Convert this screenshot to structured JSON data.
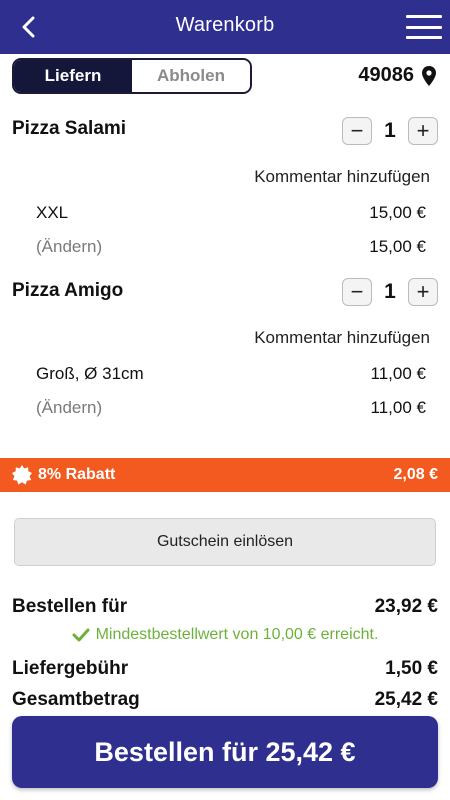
{
  "header": {
    "title": "Warenkorb",
    "back_icon": "chevron-left-icon",
    "menu_icon": "hamburger-menu-icon",
    "background": "#2e2f8f"
  },
  "delivery_toggle": {
    "options": [
      "Liefern",
      "Abholen"
    ],
    "selected": "Liefern"
  },
  "location": {
    "postal_code": "49086",
    "icon": "map-pin-icon"
  },
  "cart_items": [
    {
      "name": "Pizza Salami",
      "quantity": "1",
      "comment_label": "Kommentar hinzufügen",
      "option": "XXL",
      "option_price": "15,00 €",
      "change_label": "(Ändern)",
      "total_price": "15,00 €"
    },
    {
      "name": "Pizza Amigo",
      "quantity": "1",
      "comment_label": "Kommentar hinzufügen",
      "option": "Groß, Ø 31cm",
      "option_price": "11,00 €",
      "change_label": "(Ändern)",
      "total_price": "11,00 €"
    }
  ],
  "stepper": {
    "minus": "−",
    "plus": "+"
  },
  "discount": {
    "label": "8% Rabatt",
    "amount": "2,08 €",
    "icon": "badge-icon",
    "color": "#f25a1f"
  },
  "voucher": {
    "label": "Gutschein einlösen"
  },
  "summary": {
    "order_for_label": "Bestellen für",
    "order_for_value": "23,92 €",
    "min_order_notice": "Mindestbestellwert von 10,00 € erreicht.",
    "notice_icon": "checkmark-icon",
    "notice_color": "#6cb23a",
    "delivery_fee_label": "Liefergebühr",
    "delivery_fee_value": "1,50 €",
    "total_label": "Gesamtbetrag",
    "total_value": "25,42 €"
  },
  "order_button": {
    "label": "Bestellen für 25,42 €"
  }
}
